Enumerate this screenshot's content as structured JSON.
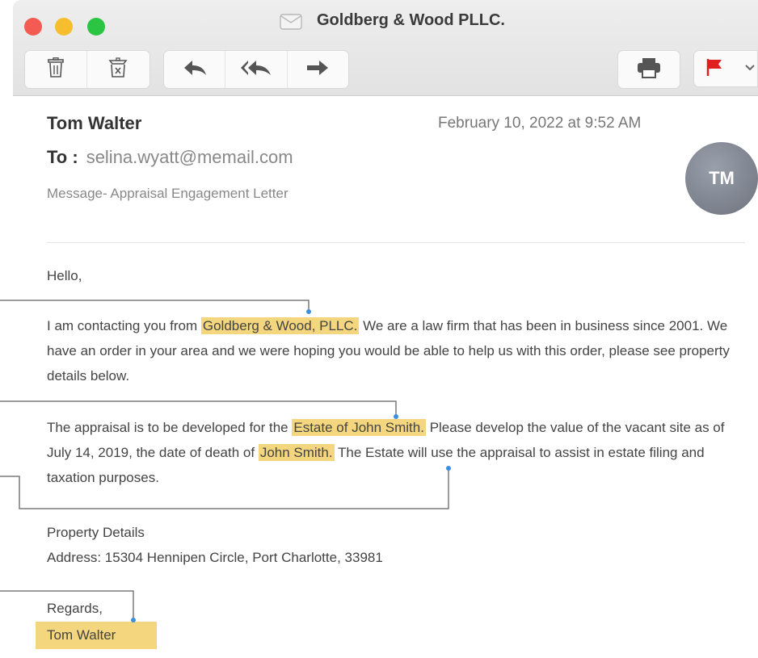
{
  "window": {
    "title": "Goldberg & Wood PLLC."
  },
  "toolbar": {
    "buttons": [
      "trash-icon",
      "junk-icon",
      "reply-icon",
      "reply-all-icon",
      "forward-icon",
      "print-icon",
      "flag-icon",
      "chevron-down-icon"
    ]
  },
  "message": {
    "sender": "Tom Walter",
    "date": "February 10, 2022 at 9:52 AM",
    "to_label": "To :",
    "to_address": "selina.wyatt@memail.com",
    "subject": "Message- Appraisal Engagement Letter",
    "avatar_initials": "TM",
    "greeting": "Hello,",
    "p1": {
      "a": "I am contacting you from ",
      "hl": "Goldberg & Wood, PLLC.",
      "b": " We are a law firm that has been in business since 2001. We have an order in your area and we were hoping you would be able to help us with this order, please see property details below."
    },
    "p2": {
      "a": "The appraisal is to be developed for the ",
      "hl1": "Estate of John Smith.",
      "b": " Please develop the value of the vacant site as of July 14, 2019, the date of death of ",
      "hl2": "John Smith.",
      "c": " The Estate will use the appraisal to assist in estate filing and taxation purposes."
    },
    "property_heading": "Property Details",
    "property_address": "Address: 15304 Hennipen Circle, Port Charlotte, 33981",
    "regards": "Regards,",
    "signature": "Tom Walter"
  },
  "colors": {
    "highlight": "#f3d67d",
    "annotation_line": "#7a7a7a",
    "annotation_dot": "#3b8fe0"
  }
}
